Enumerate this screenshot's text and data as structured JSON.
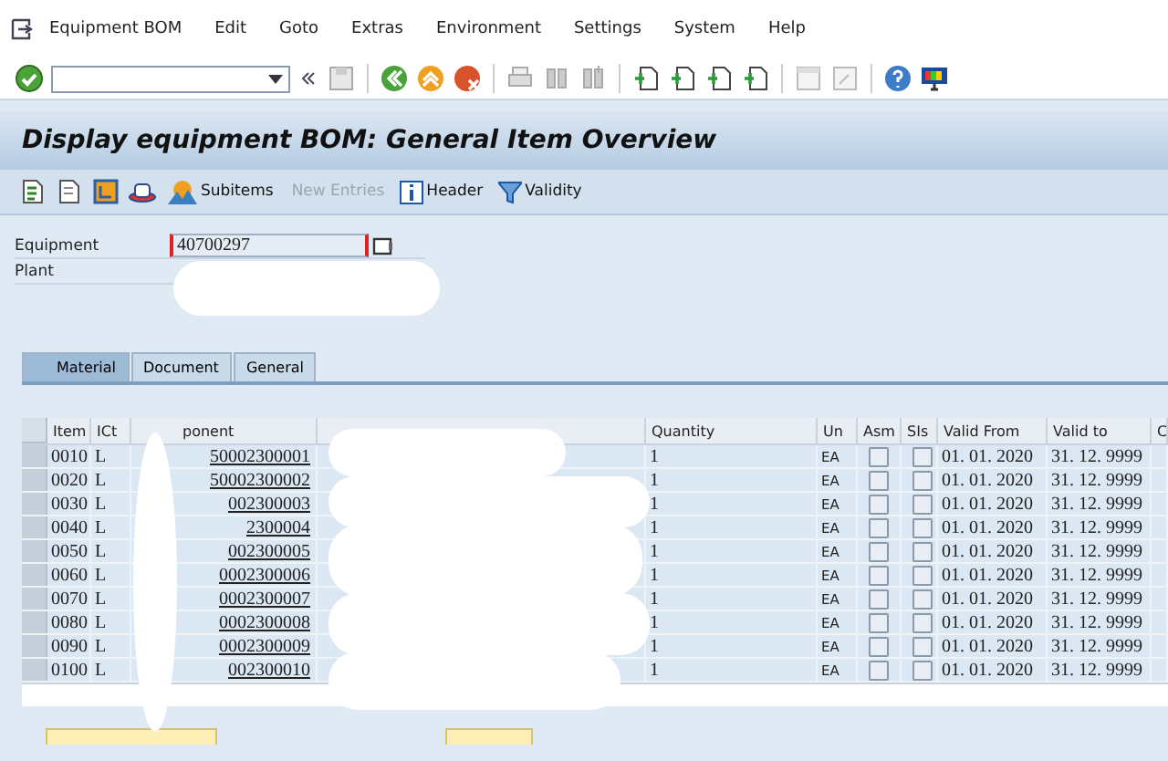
{
  "menu": [
    "Equipment BOM",
    "Edit",
    "Goto",
    "Extras",
    "Environment",
    "Settings",
    "System",
    "Help"
  ],
  "title": "Display equipment BOM: General Item Overview",
  "app_toolbar": [
    {
      "label": "Subitems",
      "disabled": false,
      "kind": "subitems"
    },
    {
      "label": "New Entries",
      "disabled": true,
      "kind": "plain"
    },
    {
      "label": "Header",
      "disabled": false,
      "kind": "info"
    },
    {
      "label": "Validity",
      "disabled": false,
      "kind": "filter"
    }
  ],
  "equipment": {
    "label": "Equipment",
    "value": "40700297"
  },
  "plant": {
    "label": "Plant"
  },
  "tabs": [
    {
      "label": "Material",
      "selected": true
    },
    {
      "label": "Document",
      "selected": false
    },
    {
      "label": "General",
      "selected": false
    }
  ],
  "table": {
    "columns": [
      "Item",
      "ICt",
      "ponent",
      "Quantity",
      "Un",
      "Asm",
      "SIs",
      "Valid From",
      "Valid to",
      "C"
    ],
    "rows": [
      {
        "item": "0010",
        "ict": "L",
        "component": "50002300001",
        "quantity": "1",
        "unit": "EA",
        "asm": false,
        "sis": false,
        "valid_from": "01. 01. 2020",
        "valid_to": "31. 12. 9999"
      },
      {
        "item": "0020",
        "ict": "L",
        "component": "50002300002",
        "quantity": "1",
        "unit": "EA",
        "asm": false,
        "sis": false,
        "valid_from": "01. 01. 2020",
        "valid_to": "31. 12. 9999"
      },
      {
        "item": "0030",
        "ict": "L",
        "component": "002300003",
        "quantity": "1",
        "unit": "EA",
        "asm": false,
        "sis": false,
        "valid_from": "01. 01. 2020",
        "valid_to": "31. 12. 9999"
      },
      {
        "item": "0040",
        "ict": "L",
        "component": "2300004",
        "quantity": "1",
        "unit": "EA",
        "asm": false,
        "sis": false,
        "valid_from": "01. 01. 2020",
        "valid_to": "31. 12. 9999"
      },
      {
        "item": "0050",
        "ict": "L",
        "component": "002300005",
        "quantity": "1",
        "unit": "EA",
        "asm": false,
        "sis": false,
        "valid_from": "01. 01. 2020",
        "valid_to": "31. 12. 9999"
      },
      {
        "item": "0060",
        "ict": "L",
        "component": "0002300006",
        "quantity": "1",
        "unit": "EA",
        "asm": false,
        "sis": false,
        "valid_from": "01. 01. 2020",
        "valid_to": "31. 12. 9999"
      },
      {
        "item": "0070",
        "ict": "L",
        "component": "0002300007",
        "quantity": "1",
        "unit": "EA",
        "asm": false,
        "sis": false,
        "valid_from": "01. 01. 2020",
        "valid_to": "31. 12. 9999"
      },
      {
        "item": "0080",
        "ict": "L",
        "component": "0002300008",
        "quantity": "1",
        "unit": "EA",
        "asm": false,
        "sis": false,
        "valid_from": "01. 01. 2020",
        "valid_to": "31. 12. 9999"
      },
      {
        "item": "0090",
        "ict": "L",
        "component": "0002300009",
        "quantity": "1",
        "unit": "EA",
        "asm": false,
        "sis": false,
        "valid_from": "01. 01. 2020",
        "valid_to": "31. 12. 9999"
      },
      {
        "item": "0100",
        "ict": "L",
        "component": "002300010",
        "quantity": "1",
        "unit": "EA",
        "asm": false,
        "sis": false,
        "valid_from": "01. 01. 2020",
        "valid_to": "31. 12. 9999"
      }
    ]
  }
}
